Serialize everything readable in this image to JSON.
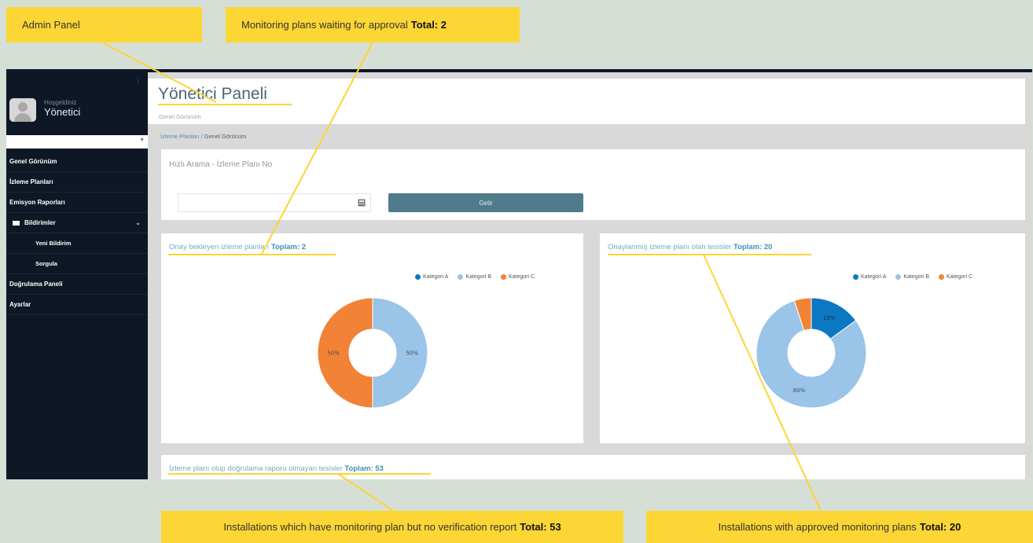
{
  "callouts": {
    "admin_panel": "Admin Panel",
    "waiting_plans": {
      "label": "Monitoring plans waiting for approval",
      "total": "Total: 2"
    },
    "no_verification": {
      "label": "Installations which have monitoring plan but no verification report",
      "total": "Total: 53"
    },
    "approved_plans": {
      "label": "Installations with approved monitoring plans",
      "total": "Total: 20"
    }
  },
  "sidebar": {
    "welcome": "Hoşgeldiniz",
    "username": "Yönetici",
    "items": [
      {
        "label": "Genel Görünüm"
      },
      {
        "label": "İzleme Planları"
      },
      {
        "label": "Emisyon Raporları"
      },
      {
        "label": "Bildirimler"
      },
      {
        "label": "Yeni Bildirim"
      },
      {
        "label": "Sorgula"
      },
      {
        "label": "Doğrulama Paneli"
      },
      {
        "label": "Ayarlar"
      }
    ]
  },
  "header": {
    "title": "Yönetici Paneli",
    "subtitle": "Genel Görünüm"
  },
  "breadcrumb": {
    "link": "İzleme Planları",
    "separator": "/",
    "current": "Genel Görünüm"
  },
  "search": {
    "title": "Hızlı Arama - İzleme Planı No",
    "input_value": "",
    "button_label": "Getir"
  },
  "colors": {
    "kategori_a": "#0b78c1",
    "kategori_b": "#9ac4e8",
    "kategori_c": "#f28235"
  },
  "charts": {
    "pending": {
      "title": "Onay bekleyen izleme planları",
      "total": "Toplam: 2"
    },
    "approved": {
      "title": "Onaylanmış izleme planı olan tesisler",
      "total": "Toplam: 20"
    },
    "no_report": {
      "title": "İzleme planı olup doğrulama raporu olmayan tesisler",
      "total": "Toplam: 53"
    }
  },
  "chart_data": [
    {
      "type": "pie",
      "categories": [
        "Kategori A",
        "Kategori B",
        "Kategori C"
      ],
      "values": [
        0,
        50,
        50
      ],
      "data_labels": [
        "",
        "50%",
        "50%"
      ],
      "legend": "top-right"
    },
    {
      "type": "pie",
      "categories": [
        "Kategori A",
        "Kategori B",
        "Kategori C"
      ],
      "values": [
        15,
        80,
        5
      ],
      "data_labels": [
        "15%",
        "80%",
        ""
      ],
      "legend": "top-right"
    }
  ]
}
